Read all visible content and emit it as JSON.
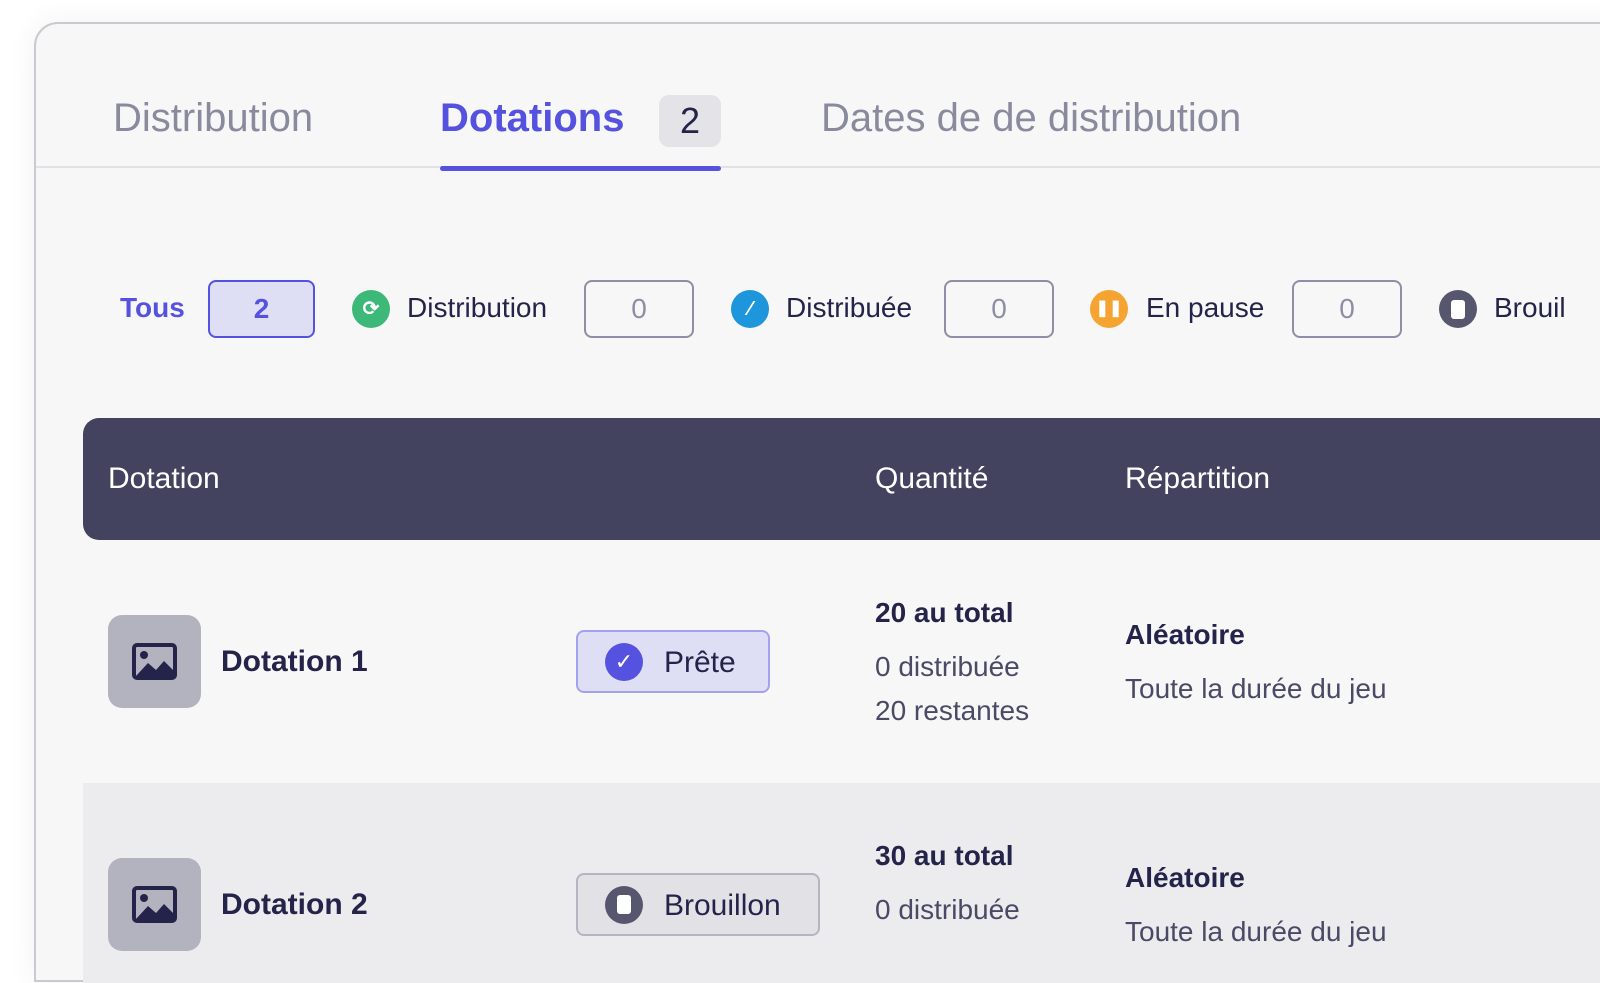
{
  "tabs": [
    {
      "label": "Distribution"
    },
    {
      "label": "Dotations",
      "badge": "2",
      "active": true
    },
    {
      "label": "Dates de de distribution"
    }
  ],
  "filters": [
    {
      "label": "Tous",
      "count": "2",
      "active": true
    },
    {
      "label": "Distribution",
      "count": "0",
      "icon": "refresh-icon",
      "color": "#3cb878"
    },
    {
      "label": "Distribuée",
      "count": "0",
      "icon": "slash-icon",
      "color": "#1e96dc"
    },
    {
      "label": "En pause",
      "count": "0",
      "icon": "pause-icon",
      "color": "#f5a431"
    },
    {
      "label": "Brouil",
      "icon": "document-icon",
      "color": "#57566f"
    }
  ],
  "table": {
    "headers": [
      "Dotation",
      "Quantité",
      "Répartition"
    ],
    "rows": [
      {
        "name": "Dotation 1",
        "status": "Prête",
        "status_icon": "check-icon",
        "total": "20 au total",
        "distributed": "0 distribuée",
        "remaining": "20 restantes",
        "repartition": "Aléatoire",
        "repartition_detail": "Toute la durée du jeu"
      },
      {
        "name": "Dotation 2",
        "status": "Brouillon",
        "status_icon": "document-icon",
        "total": "30 au total",
        "distributed": "0 distribuée",
        "repartition": "Aléatoire",
        "repartition_detail": "Toute la durée du jeu"
      }
    ]
  },
  "colors": {
    "accent": "#5552e0",
    "header": "#43425f"
  }
}
